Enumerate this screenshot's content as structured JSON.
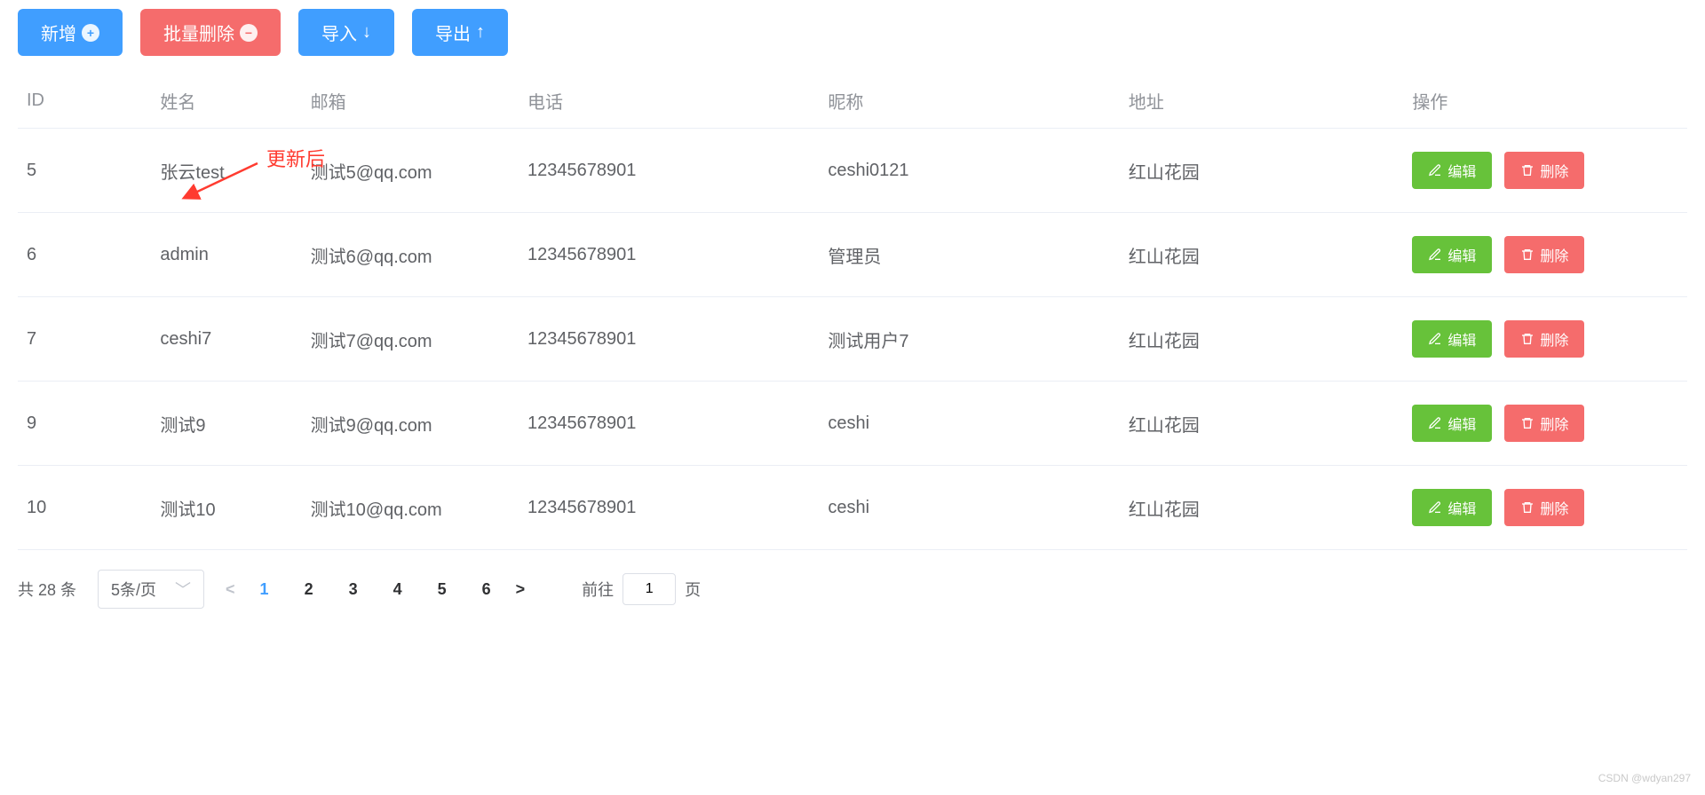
{
  "toolbar": {
    "add_label": "新增",
    "batch_delete_label": "批量删除",
    "import_label": "导入",
    "export_label": "导出"
  },
  "annotation": {
    "text": "更新后"
  },
  "columns": {
    "id": "ID",
    "name": "姓名",
    "email": "邮箱",
    "phone": "电话",
    "nickname": "昵称",
    "address": "地址",
    "ops": "操作"
  },
  "ops": {
    "edit": "编辑",
    "delete": "删除"
  },
  "rows": [
    {
      "id": "5",
      "name": "张云test",
      "email": "测试5@qq.com",
      "phone": "12345678901",
      "nickname": "ceshi0121",
      "address": "红山花园"
    },
    {
      "id": "6",
      "name": "admin",
      "email": "测试6@qq.com",
      "phone": "12345678901",
      "nickname": "管理员",
      "address": "红山花园"
    },
    {
      "id": "7",
      "name": "ceshi7",
      "email": "测试7@qq.com",
      "phone": "12345678901",
      "nickname": "测试用户7",
      "address": "红山花园"
    },
    {
      "id": "9",
      "name": "测试9",
      "email": "测试9@qq.com",
      "phone": "12345678901",
      "nickname": "ceshi",
      "address": "红山花园"
    },
    {
      "id": "10",
      "name": "测试10",
      "email": "测试10@qq.com",
      "phone": "12345678901",
      "nickname": "ceshi",
      "address": "红山花园"
    }
  ],
  "pagination": {
    "total_text": "共 28 条",
    "page_size_label": "5条/页",
    "pages": [
      "1",
      "2",
      "3",
      "4",
      "5",
      "6"
    ],
    "active_page": "1",
    "goto_prefix": "前往",
    "goto_value": "1",
    "goto_suffix": "页"
  },
  "watermark": "CSDN @wdyan297"
}
